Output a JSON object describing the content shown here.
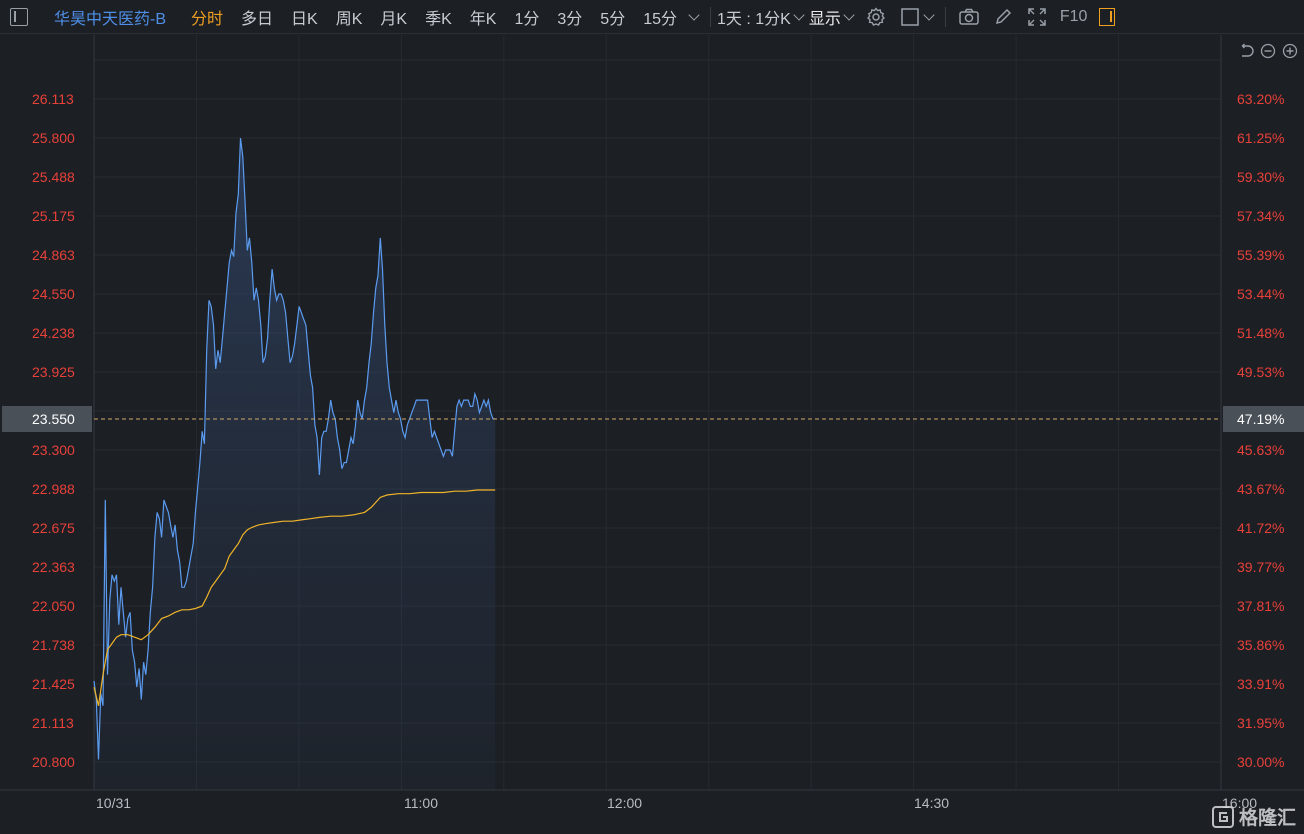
{
  "toolbar": {
    "stock_name": "华昊中天医药-B",
    "tabs": [
      "分时",
      "多日",
      "日K",
      "周K",
      "月K",
      "季K",
      "年K",
      "1分",
      "3分",
      "5分",
      "15分"
    ],
    "active_tab": "分时",
    "range_label": "1天 : 1分K",
    "display_label": "显示",
    "f10_label": "F10"
  },
  "colors": {
    "background": "#1c1f24",
    "price_line": "#5b9bf0",
    "avg_line": "#f0b429",
    "axis_text": "#e8413a",
    "ref_line": "#d4a86a"
  },
  "chart_data": {
    "type": "line",
    "price_ticks": [
      "26.113",
      "25.800",
      "25.488",
      "25.175",
      "24.863",
      "24.550",
      "24.238",
      "23.925",
      "23.300",
      "22.988",
      "22.675",
      "22.363",
      "22.050",
      "21.738",
      "21.425",
      "21.113",
      "20.800"
    ],
    "pct_ticks": [
      "63.20%",
      "61.25%",
      "59.30%",
      "57.34%",
      "55.39%",
      "53.44%",
      "51.48%",
      "49.53%",
      "45.63%",
      "43.67%",
      "41.72%",
      "39.77%",
      "37.81%",
      "35.86%",
      "33.91%",
      "31.95%",
      "30.00%"
    ],
    "current_price": "23.550",
    "current_pct": "47.19%",
    "time_labels": [
      "10/31",
      "11:00",
      "12:00",
      "14:30",
      "16:00"
    ],
    "ylim": [
      20.8,
      26.113
    ],
    "xlim": [
      0,
      1
    ],
    "series": [
      {
        "values": [
          [
            0.0,
            21.45
          ],
          [
            0.002,
            21.3
          ],
          [
            0.004,
            20.82
          ],
          [
            0.006,
            21.35
          ],
          [
            0.008,
            21.25
          ],
          [
            0.01,
            22.9
          ],
          [
            0.012,
            21.5
          ],
          [
            0.014,
            22.1
          ],
          [
            0.016,
            22.3
          ],
          [
            0.018,
            22.25
          ],
          [
            0.02,
            22.3
          ],
          [
            0.022,
            21.9
          ],
          [
            0.024,
            22.2
          ],
          [
            0.026,
            22.0
          ],
          [
            0.028,
            21.8
          ],
          [
            0.03,
            21.95
          ],
          [
            0.032,
            22.0
          ],
          [
            0.034,
            21.7
          ],
          [
            0.036,
            21.6
          ],
          [
            0.038,
            21.4
          ],
          [
            0.04,
            21.55
          ],
          [
            0.042,
            21.3
          ],
          [
            0.044,
            21.6
          ],
          [
            0.046,
            21.5
          ],
          [
            0.048,
            21.7
          ],
          [
            0.05,
            22.0
          ],
          [
            0.052,
            22.2
          ],
          [
            0.054,
            22.6
          ],
          [
            0.056,
            22.8
          ],
          [
            0.058,
            22.75
          ],
          [
            0.06,
            22.6
          ],
          [
            0.062,
            22.9
          ],
          [
            0.064,
            22.85
          ],
          [
            0.066,
            22.8
          ],
          [
            0.068,
            22.7
          ],
          [
            0.07,
            22.6
          ],
          [
            0.072,
            22.7
          ],
          [
            0.074,
            22.5
          ],
          [
            0.076,
            22.4
          ],
          [
            0.078,
            22.2
          ],
          [
            0.08,
            22.2
          ],
          [
            0.082,
            22.25
          ],
          [
            0.084,
            22.35
          ],
          [
            0.086,
            22.45
          ],
          [
            0.088,
            22.55
          ],
          [
            0.09,
            22.8
          ],
          [
            0.092,
            23.0
          ],
          [
            0.094,
            23.2
          ],
          [
            0.096,
            23.45
          ],
          [
            0.098,
            23.35
          ],
          [
            0.1,
            24.1
          ],
          [
            0.102,
            24.5
          ],
          [
            0.104,
            24.45
          ],
          [
            0.106,
            24.3
          ],
          [
            0.108,
            23.95
          ],
          [
            0.11,
            24.1
          ],
          [
            0.112,
            24.0
          ],
          [
            0.114,
            24.2
          ],
          [
            0.116,
            24.4
          ],
          [
            0.118,
            24.6
          ],
          [
            0.12,
            24.8
          ],
          [
            0.122,
            24.9
          ],
          [
            0.124,
            24.85
          ],
          [
            0.126,
            25.2
          ],
          [
            0.128,
            25.35
          ],
          [
            0.13,
            25.8
          ],
          [
            0.132,
            25.65
          ],
          [
            0.134,
            25.3
          ],
          [
            0.136,
            24.9
          ],
          [
            0.138,
            25.0
          ],
          [
            0.14,
            24.8
          ],
          [
            0.142,
            24.5
          ],
          [
            0.144,
            24.6
          ],
          [
            0.146,
            24.5
          ],
          [
            0.148,
            24.3
          ],
          [
            0.15,
            24.0
          ],
          [
            0.152,
            24.05
          ],
          [
            0.154,
            24.2
          ],
          [
            0.156,
            24.5
          ],
          [
            0.158,
            24.75
          ],
          [
            0.16,
            24.6
          ],
          [
            0.162,
            24.5
          ],
          [
            0.164,
            24.55
          ],
          [
            0.166,
            24.55
          ],
          [
            0.168,
            24.5
          ],
          [
            0.17,
            24.4
          ],
          [
            0.172,
            24.2
          ],
          [
            0.174,
            24.0
          ],
          [
            0.176,
            24.05
          ],
          [
            0.178,
            24.15
          ],
          [
            0.18,
            24.3
          ],
          [
            0.182,
            24.45
          ],
          [
            0.184,
            24.4
          ],
          [
            0.186,
            24.35
          ],
          [
            0.188,
            24.3
          ],
          [
            0.19,
            24.1
          ],
          [
            0.192,
            23.9
          ],
          [
            0.194,
            23.8
          ],
          [
            0.196,
            23.5
          ],
          [
            0.198,
            23.4
          ],
          [
            0.2,
            23.1
          ],
          [
            0.202,
            23.4
          ],
          [
            0.204,
            23.45
          ],
          [
            0.206,
            23.45
          ],
          [
            0.208,
            23.55
          ],
          [
            0.21,
            23.7
          ],
          [
            0.212,
            23.6
          ],
          [
            0.214,
            23.55
          ],
          [
            0.216,
            23.4
          ],
          [
            0.218,
            23.3
          ],
          [
            0.22,
            23.15
          ],
          [
            0.222,
            23.2
          ],
          [
            0.224,
            23.2
          ],
          [
            0.226,
            23.3
          ],
          [
            0.228,
            23.4
          ],
          [
            0.23,
            23.35
          ],
          [
            0.232,
            23.5
          ],
          [
            0.234,
            23.7
          ],
          [
            0.236,
            23.6
          ],
          [
            0.238,
            23.55
          ],
          [
            0.24,
            23.7
          ],
          [
            0.242,
            23.8
          ],
          [
            0.244,
            24.0
          ],
          [
            0.246,
            24.15
          ],
          [
            0.248,
            24.4
          ],
          [
            0.25,
            24.6
          ],
          [
            0.252,
            24.7
          ],
          [
            0.254,
            25.0
          ],
          [
            0.256,
            24.75
          ],
          [
            0.258,
            24.3
          ],
          [
            0.26,
            24.0
          ],
          [
            0.262,
            23.8
          ],
          [
            0.264,
            23.7
          ],
          [
            0.266,
            23.6
          ],
          [
            0.268,
            23.7
          ],
          [
            0.27,
            23.6
          ],
          [
            0.272,
            23.55
          ],
          [
            0.274,
            23.45
          ],
          [
            0.276,
            23.4
          ],
          [
            0.278,
            23.5
          ],
          [
            0.28,
            23.55
          ],
          [
            0.282,
            23.6
          ],
          [
            0.284,
            23.65
          ],
          [
            0.286,
            23.7
          ],
          [
            0.288,
            23.7
          ],
          [
            0.29,
            23.7
          ],
          [
            0.292,
            23.7
          ],
          [
            0.294,
            23.7
          ],
          [
            0.296,
            23.7
          ],
          [
            0.298,
            23.55
          ],
          [
            0.3,
            23.4
          ],
          [
            0.302,
            23.45
          ],
          [
            0.304,
            23.4
          ],
          [
            0.306,
            23.35
          ],
          [
            0.308,
            23.3
          ],
          [
            0.31,
            23.25
          ],
          [
            0.312,
            23.3
          ],
          [
            0.314,
            23.3
          ],
          [
            0.316,
            23.3
          ],
          [
            0.318,
            23.25
          ],
          [
            0.32,
            23.45
          ],
          [
            0.322,
            23.65
          ],
          [
            0.324,
            23.7
          ],
          [
            0.326,
            23.65
          ],
          [
            0.328,
            23.7
          ],
          [
            0.33,
            23.7
          ],
          [
            0.332,
            23.7
          ],
          [
            0.334,
            23.65
          ],
          [
            0.336,
            23.65
          ],
          [
            0.338,
            23.75
          ],
          [
            0.34,
            23.7
          ],
          [
            0.342,
            23.6
          ],
          [
            0.344,
            23.65
          ],
          [
            0.346,
            23.7
          ],
          [
            0.348,
            23.65
          ],
          [
            0.35,
            23.7
          ],
          [
            0.352,
            23.6
          ],
          [
            0.354,
            23.55
          ],
          [
            0.356,
            23.55
          ]
        ]
      },
      {
        "values": [
          [
            0.0,
            21.4
          ],
          [
            0.004,
            21.25
          ],
          [
            0.008,
            21.5
          ],
          [
            0.012,
            21.7
          ],
          [
            0.016,
            21.75
          ],
          [
            0.02,
            21.8
          ],
          [
            0.024,
            21.82
          ],
          [
            0.03,
            21.82
          ],
          [
            0.036,
            21.8
          ],
          [
            0.042,
            21.78
          ],
          [
            0.048,
            21.82
          ],
          [
            0.054,
            21.88
          ],
          [
            0.06,
            21.95
          ],
          [
            0.066,
            21.97
          ],
          [
            0.072,
            22.0
          ],
          [
            0.078,
            22.02
          ],
          [
            0.084,
            22.02
          ],
          [
            0.09,
            22.03
          ],
          [
            0.096,
            22.05
          ],
          [
            0.1,
            22.12
          ],
          [
            0.104,
            22.2
          ],
          [
            0.108,
            22.25
          ],
          [
            0.112,
            22.3
          ],
          [
            0.116,
            22.35
          ],
          [
            0.12,
            22.45
          ],
          [
            0.124,
            22.5
          ],
          [
            0.128,
            22.55
          ],
          [
            0.132,
            22.62
          ],
          [
            0.136,
            22.66
          ],
          [
            0.14,
            22.68
          ],
          [
            0.146,
            22.7
          ],
          [
            0.152,
            22.71
          ],
          [
            0.16,
            22.72
          ],
          [
            0.168,
            22.73
          ],
          [
            0.176,
            22.73
          ],
          [
            0.184,
            22.74
          ],
          [
            0.192,
            22.75
          ],
          [
            0.2,
            22.76
          ],
          [
            0.21,
            22.77
          ],
          [
            0.22,
            22.77
          ],
          [
            0.23,
            22.78
          ],
          [
            0.24,
            22.8
          ],
          [
            0.246,
            22.84
          ],
          [
            0.25,
            22.88
          ],
          [
            0.254,
            22.92
          ],
          [
            0.26,
            22.94
          ],
          [
            0.27,
            22.95
          ],
          [
            0.28,
            22.95
          ],
          [
            0.29,
            22.96
          ],
          [
            0.3,
            22.96
          ],
          [
            0.31,
            22.96
          ],
          [
            0.32,
            22.97
          ],
          [
            0.33,
            22.97
          ],
          [
            0.34,
            22.98
          ],
          [
            0.356,
            22.98
          ]
        ]
      }
    ]
  }
}
